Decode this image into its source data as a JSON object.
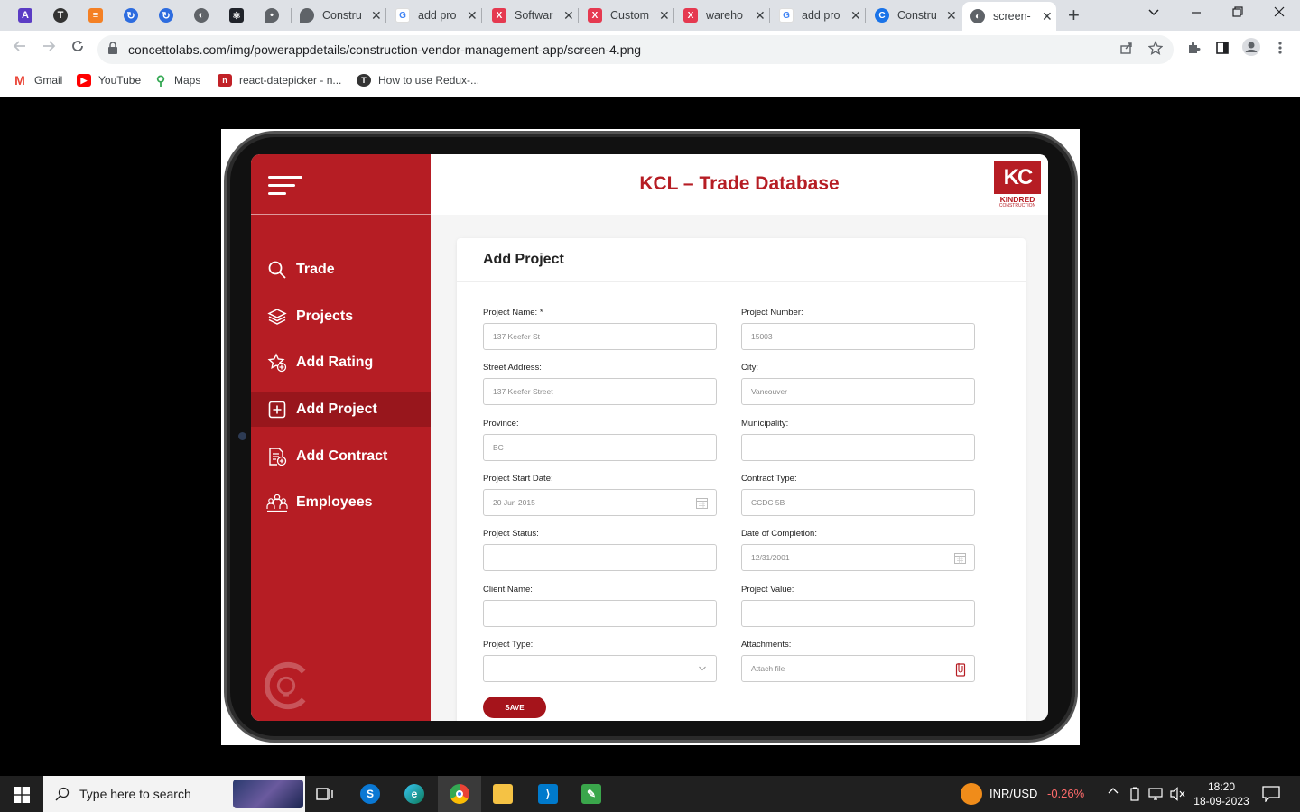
{
  "browser": {
    "tabs": [
      {
        "title": "Constru",
        "icon": "maps-icon",
        "color": "#5f6368"
      },
      {
        "title": "add pro",
        "icon": "google-icon",
        "color": "#4285f4"
      },
      {
        "title": "Softwar",
        "icon": "xb-icon",
        "color": "#e53950"
      },
      {
        "title": "Custom",
        "icon": "xb-icon",
        "color": "#e53950"
      },
      {
        "title": "wareho",
        "icon": "xb-icon",
        "color": "#e53950"
      },
      {
        "title": "add pro",
        "icon": "google-icon",
        "color": "#4285f4"
      },
      {
        "title": "Constru",
        "icon": "concetto-icon",
        "color": "#1a73e8"
      },
      {
        "title": "screen-",
        "icon": "globe-icon",
        "color": "#5f6368"
      }
    ],
    "tab_close": "✕",
    "new_tab": "+",
    "url": "concettolabs.com/img/powerappdetails/construction-vendor-management-app/screen-4.png",
    "bookmarks": [
      {
        "label": "Gmail",
        "color": "#ea4335"
      },
      {
        "label": "YouTube",
        "color": "#ff0000"
      },
      {
        "label": "Maps",
        "color": "#34a853"
      },
      {
        "label": "react-datepicker - n...",
        "color": "#c12127"
      },
      {
        "label": "How to use Redux-...",
        "color": "#333333"
      }
    ]
  },
  "app": {
    "title": "KCL – Trade Database",
    "brand": {
      "mark": "KC",
      "name": "KINDRED",
      "sub": "CONSTRUCTION"
    },
    "accent": "#b61d24",
    "nav": [
      {
        "label": "Trade",
        "icon": "search-icon"
      },
      {
        "label": "Projects",
        "icon": "layers-icon"
      },
      {
        "label": "Add Rating",
        "icon": "star-add-icon"
      },
      {
        "label": "Add Project",
        "icon": "plus-square-icon",
        "active": true
      },
      {
        "label": "Add Contract",
        "icon": "contract-add-icon"
      },
      {
        "label": "Employees",
        "icon": "people-icon"
      }
    ],
    "form": {
      "title": "Add Project",
      "fields": [
        {
          "label": "Project Name: *",
          "value": "137 Keefer St"
        },
        {
          "label": "Project Number:",
          "value": "15003"
        },
        {
          "label": "Street Address:",
          "value": "137 Keefer Street"
        },
        {
          "label": "City:",
          "value": "Vancouver"
        },
        {
          "label": "Province:",
          "value": "BC"
        },
        {
          "label": "Municipality:",
          "value": ""
        },
        {
          "label": "Project Start Date:",
          "value": "20 Jun 2015"
        },
        {
          "label": "Contract Type:",
          "value": "CCDC 5B"
        },
        {
          "label": "Project Status:",
          "value": ""
        },
        {
          "label": "Date of Completion:",
          "value": "12/31/2001"
        },
        {
          "label": "Client Name:",
          "value": ""
        },
        {
          "label": "Project Value:",
          "value": ""
        },
        {
          "label": "Project Type:",
          "value": ""
        },
        {
          "label": "Attachments:",
          "value": "Attach file"
        }
      ],
      "save_label": "SAVE"
    }
  },
  "taskbar": {
    "search_placeholder": "Type here to search",
    "ticker": "INR/USD",
    "ticker_change": "-0.26%",
    "time": "18:20",
    "date": "18-09-2023"
  }
}
